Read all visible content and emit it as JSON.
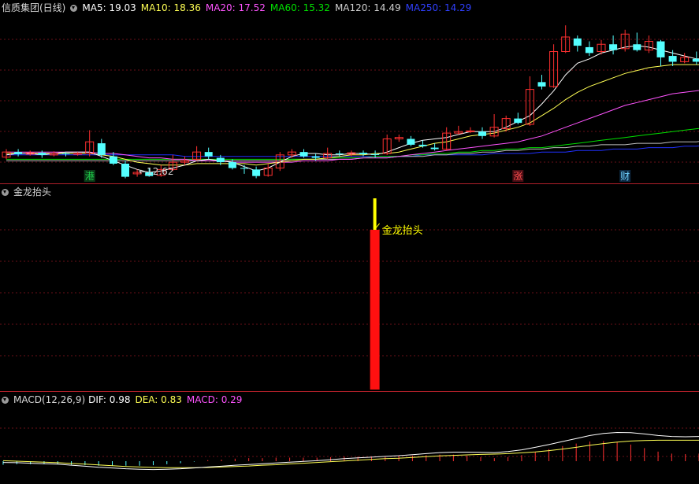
{
  "header": {
    "stock_name": "信质集团(日线)",
    "ma5": "MA5: 19.03",
    "ma10": "MA10: 18.36",
    "ma20": "MA20: 17.52",
    "ma60": "MA60: 15.32",
    "ma120": "MA120: 14.49",
    "ma250": "MA250: 14.29"
  },
  "price_annotation": "←12.62",
  "badges": [
    {
      "text": "港",
      "color": "#1fcf4a",
      "bg": "#0b3b18"
    },
    {
      "text": "涨",
      "color": "#ff5050",
      "bg": "#4a0d14"
    },
    {
      "text": "财",
      "color": "#6fd0ff",
      "bg": "#0d2a44"
    }
  ],
  "indicator": {
    "title": "金龙抬头",
    "signal_label": "金龙抬头"
  },
  "macd": {
    "label": "MACD(12,26,9)",
    "dif": "DIF: 0.98",
    "dea": "DEA: 0.83",
    "macd": "MACD: 0.29"
  },
  "colors": {
    "up": "#ff3030",
    "down": "#54ffff",
    "ma5": "#ffffff",
    "ma10": "#ffff54",
    "ma20": "#ff54ff",
    "ma60": "#00e000",
    "ma120": "#c0c0c0",
    "ma250": "#2030ff",
    "grid": "#6a1018",
    "signal_bar": "#ff1010",
    "signal_tip": "#ffff00"
  },
  "chart_data": {
    "type": "candlestick",
    "candles": [
      [
        13.25,
        13.6,
        13.8,
        13.1
      ],
      [
        13.6,
        13.45,
        13.8,
        13.3
      ],
      [
        13.45,
        13.55,
        13.7,
        13.35
      ],
      [
        13.55,
        13.4,
        13.7,
        13.2
      ],
      [
        13.4,
        13.5,
        13.65,
        13.3
      ],
      [
        13.5,
        13.45,
        13.6,
        13.3
      ],
      [
        13.45,
        13.5,
        13.6,
        13.35
      ],
      [
        13.5,
        14.3,
        15.1,
        13.3
      ],
      [
        14.2,
        13.4,
        14.5,
        13.2
      ],
      [
        13.3,
        12.8,
        13.6,
        12.7
      ],
      [
        12.8,
        11.9,
        13.0,
        11.8
      ],
      [
        12.1,
        12.2,
        12.4,
        11.9
      ],
      [
        12.2,
        11.95,
        12.5,
        11.9
      ],
      [
        12.0,
        12.4,
        12.7,
        11.9
      ],
      [
        12.4,
        12.9,
        13.4,
        12.3
      ],
      [
        12.9,
        13.0,
        13.3,
        12.7
      ],
      [
        13.1,
        13.6,
        14.0,
        13.0
      ],
      [
        13.6,
        13.3,
        13.9,
        13.1
      ],
      [
        13.2,
        12.9,
        13.4,
        12.7
      ],
      [
        12.9,
        12.5,
        13.1,
        12.4
      ],
      [
        12.5,
        12.45,
        12.7,
        12.1
      ],
      [
        12.4,
        11.95,
        12.6,
        11.8
      ],
      [
        12.0,
        12.5,
        12.8,
        11.9
      ],
      [
        12.5,
        13.4,
        13.6,
        12.3
      ],
      [
        13.4,
        13.6,
        13.8,
        13.2
      ],
      [
        13.6,
        13.3,
        13.8,
        13.2
      ],
      [
        13.3,
        13.2,
        13.5,
        13.0
      ],
      [
        13.2,
        13.5,
        13.9,
        13.1
      ],
      [
        13.5,
        13.45,
        13.7,
        13.3
      ],
      [
        13.45,
        13.55,
        13.7,
        13.3
      ],
      [
        13.55,
        13.45,
        13.7,
        13.3
      ],
      [
        13.45,
        13.4,
        13.7,
        13.2
      ],
      [
        13.5,
        14.5,
        14.8,
        13.4
      ],
      [
        14.5,
        14.6,
        14.8,
        14.3
      ],
      [
        14.5,
        14.1,
        14.7,
        14.0
      ],
      [
        14.1,
        14.0,
        14.4,
        13.9
      ],
      [
        13.9,
        13.8,
        14.2,
        13.7
      ],
      [
        13.8,
        14.9,
        15.3,
        13.7
      ],
      [
        14.9,
        15.0,
        15.4,
        14.8
      ],
      [
        15.0,
        15.05,
        15.3,
        14.9
      ],
      [
        15.0,
        14.7,
        15.3,
        14.5
      ],
      [
        14.7,
        15.3,
        16.2,
        14.6
      ],
      [
        15.2,
        15.9,
        16.1,
        15.0
      ],
      [
        15.9,
        15.6,
        16.3,
        15.5
      ],
      [
        15.5,
        17.9,
        18.8,
        15.4
      ],
      [
        18.4,
        18.1,
        18.9,
        17.9
      ],
      [
        18.1,
        20.5,
        21.0,
        18.0
      ],
      [
        20.5,
        21.5,
        22.3,
        20.4
      ],
      [
        21.4,
        20.9,
        21.6,
        20.5
      ],
      [
        20.8,
        20.4,
        21.2,
        20.2
      ],
      [
        20.5,
        21.0,
        21.3,
        20.3
      ],
      [
        21.0,
        20.6,
        21.6,
        20.3
      ],
      [
        20.7,
        21.7,
        22.0,
        20.5
      ],
      [
        21.0,
        20.6,
        21.8,
        20.5
      ],
      [
        20.6,
        21.2,
        21.6,
        20.4
      ],
      [
        21.2,
        20.1,
        21.3,
        19.5
      ],
      [
        20.2,
        19.8,
        20.6,
        19.5
      ],
      [
        19.8,
        20.1,
        20.4,
        19.7
      ],
      [
        20.0,
        19.8,
        20.5,
        19.6
      ],
      [
        19.9,
        20.4,
        20.7,
        19.6
      ],
      [
        20.4,
        21.0,
        21.4,
        20.0
      ]
    ],
    "ma5": [
      13.4,
      13.5,
      13.5,
      13.4,
      13.5,
      13.6,
      13.6,
      13.6,
      13.3,
      13.0,
      12.7,
      12.4,
      12.2,
      12.3,
      12.5,
      12.7,
      13.0,
      13.1,
      13.0,
      12.9,
      12.6,
      12.3,
      12.5,
      12.9,
      13.3,
      13.5,
      13.5,
      13.4,
      13.4,
      13.5,
      13.5,
      13.4,
      13.6,
      13.9,
      14.2,
      14.4,
      14.5,
      14.6,
      14.8,
      15.0,
      15.0,
      15.0,
      15.3,
      15.7,
      16.1,
      16.9,
      17.8,
      18.9,
      19.7,
      20.0,
      20.4,
      20.6,
      20.8,
      20.9,
      20.8,
      20.6,
      20.4,
      20.2,
      20.0,
      20.0,
      20.1
    ],
    "ma10": [
      13.5,
      13.5,
      13.5,
      13.5,
      13.5,
      13.5,
      13.5,
      13.5,
      13.4,
      13.3,
      13.1,
      12.9,
      12.8,
      12.7,
      12.7,
      12.7,
      12.8,
      12.8,
      12.8,
      12.8,
      12.8,
      12.7,
      12.8,
      12.9,
      13.0,
      13.1,
      13.1,
      13.2,
      13.3,
      13.4,
      13.4,
      13.5,
      13.5,
      13.6,
      13.8,
      14.0,
      14.2,
      14.3,
      14.5,
      14.7,
      14.8,
      14.9,
      15.1,
      15.3,
      15.6,
      16.1,
      16.6,
      17.2,
      17.7,
      18.1,
      18.4,
      18.7,
      19.0,
      19.2,
      19.4,
      19.5,
      19.6,
      19.6,
      19.6,
      19.6,
      19.6
    ],
    "ma20": [
      13.6,
      13.6,
      13.6,
      13.6,
      13.6,
      13.6,
      13.6,
      13.6,
      13.5,
      13.5,
      13.4,
      13.3,
      13.2,
      13.2,
      13.1,
      13.1,
      13.0,
      13.0,
      13.0,
      12.9,
      12.9,
      12.9,
      12.9,
      12.9,
      12.9,
      13.0,
      13.0,
      13.0,
      13.1,
      13.1,
      13.2,
      13.2,
      13.2,
      13.3,
      13.4,
      13.5,
      13.6,
      13.7,
      13.8,
      13.9,
      14.0,
      14.1,
      14.2,
      14.3,
      14.5,
      14.7,
      15.0,
      15.3,
      15.6,
      15.9,
      16.2,
      16.5,
      16.8,
      17.0,
      17.2,
      17.4,
      17.6,
      17.7,
      17.8,
      17.9,
      18.0
    ],
    "ma60": [
      13.1,
      13.1,
      13.1,
      13.1,
      13.1,
      13.1,
      13.1,
      13.1,
      13.1,
      13.1,
      13.1,
      13.1,
      13.1,
      13.1,
      13.1,
      13.1,
      13.1,
      13.1,
      13.1,
      13.1,
      13.1,
      13.1,
      13.1,
      13.1,
      13.1,
      13.1,
      13.1,
      13.2,
      13.2,
      13.2,
      13.2,
      13.3,
      13.3,
      13.3,
      13.4,
      13.4,
      13.5,
      13.5,
      13.6,
      13.6,
      13.7,
      13.7,
      13.8,
      13.8,
      13.9,
      13.9,
      14.0,
      14.1,
      14.2,
      14.3,
      14.4,
      14.5,
      14.6,
      14.7,
      14.8,
      14.9,
      15.0,
      15.1,
      15.2,
      15.3,
      15.4
    ],
    "ma120": [
      13.0,
      13.0,
      13.0,
      13.0,
      13.0,
      13.0,
      13.0,
      13.0,
      13.0,
      13.0,
      13.0,
      13.0,
      13.0,
      13.0,
      13.0,
      13.0,
      13.0,
      13.0,
      13.0,
      13.0,
      13.0,
      13.0,
      13.0,
      13.0,
      13.1,
      13.1,
      13.1,
      13.1,
      13.1,
      13.1,
      13.2,
      13.2,
      13.2,
      13.3,
      13.3,
      13.3,
      13.4,
      13.4,
      13.5,
      13.5,
      13.6,
      13.6,
      13.7,
      13.7,
      13.8,
      13.8,
      13.9,
      13.9,
      14.0,
      14.0,
      14.1,
      14.1,
      14.1,
      14.2,
      14.2,
      14.2,
      14.3,
      14.3,
      14.3,
      14.4,
      14.4
    ],
    "ma250": [
      13.4,
      13.4,
      13.4,
      13.4,
      13.4,
      13.4,
      13.4,
      13.4,
      13.4,
      13.4,
      13.4,
      13.4,
      13.4,
      13.4,
      13.4,
      13.3,
      13.3,
      13.3,
      13.3,
      13.3,
      13.3,
      13.3,
      13.3,
      13.3,
      13.3,
      13.3,
      13.3,
      13.3,
      13.3,
      13.3,
      13.3,
      13.3,
      13.3,
      13.3,
      13.3,
      13.4,
      13.4,
      13.4,
      13.4,
      13.4,
      13.4,
      13.5,
      13.5,
      13.5,
      13.5,
      13.6,
      13.6,
      13.6,
      13.7,
      13.7,
      13.7,
      13.8,
      13.8,
      13.8,
      13.9,
      13.9,
      13.9,
      14.0,
      14.0,
      14.1,
      14.1
    ],
    "signal": {
      "index": 31,
      "value": 1.0
    },
    "dif": [
      -0.05,
      -0.06,
      -0.08,
      -0.1,
      -0.12,
      -0.16,
      -0.2,
      -0.24,
      -0.27,
      -0.3,
      -0.32,
      -0.33,
      -0.32,
      -0.3,
      -0.27,
      -0.23,
      -0.2,
      -0.16,
      -0.13,
      -0.1,
      -0.07,
      -0.04,
      -0.01,
      0.02,
      0.06,
      0.1,
      0.13,
      0.16,
      0.19,
      0.22,
      0.26,
      0.3,
      0.34,
      0.36,
      0.36,
      0.35,
      0.34,
      0.38,
      0.45,
      0.55,
      0.66,
      0.78,
      0.9,
      1.02,
      1.1,
      1.14,
      1.13,
      1.08,
      1.02,
      0.98,
      0.97,
      0.98
    ],
    "dea": [
      0.02,
      0.0,
      -0.02,
      -0.04,
      -0.06,
      -0.09,
      -0.12,
      -0.15,
      -0.18,
      -0.21,
      -0.23,
      -0.25,
      -0.26,
      -0.26,
      -0.26,
      -0.25,
      -0.23,
      -0.21,
      -0.19,
      -0.16,
      -0.14,
      -0.11,
      -0.08,
      -0.05,
      -0.02,
      0.01,
      0.04,
      0.07,
      0.1,
      0.12,
      0.15,
      0.18,
      0.21,
      0.23,
      0.25,
      0.27,
      0.28,
      0.3,
      0.33,
      0.37,
      0.42,
      0.48,
      0.55,
      0.63,
      0.7,
      0.76,
      0.8,
      0.82,
      0.83,
      0.83,
      0.83,
      0.83
    ],
    "ylim_price": [
      11.5,
      23.5
    ]
  }
}
